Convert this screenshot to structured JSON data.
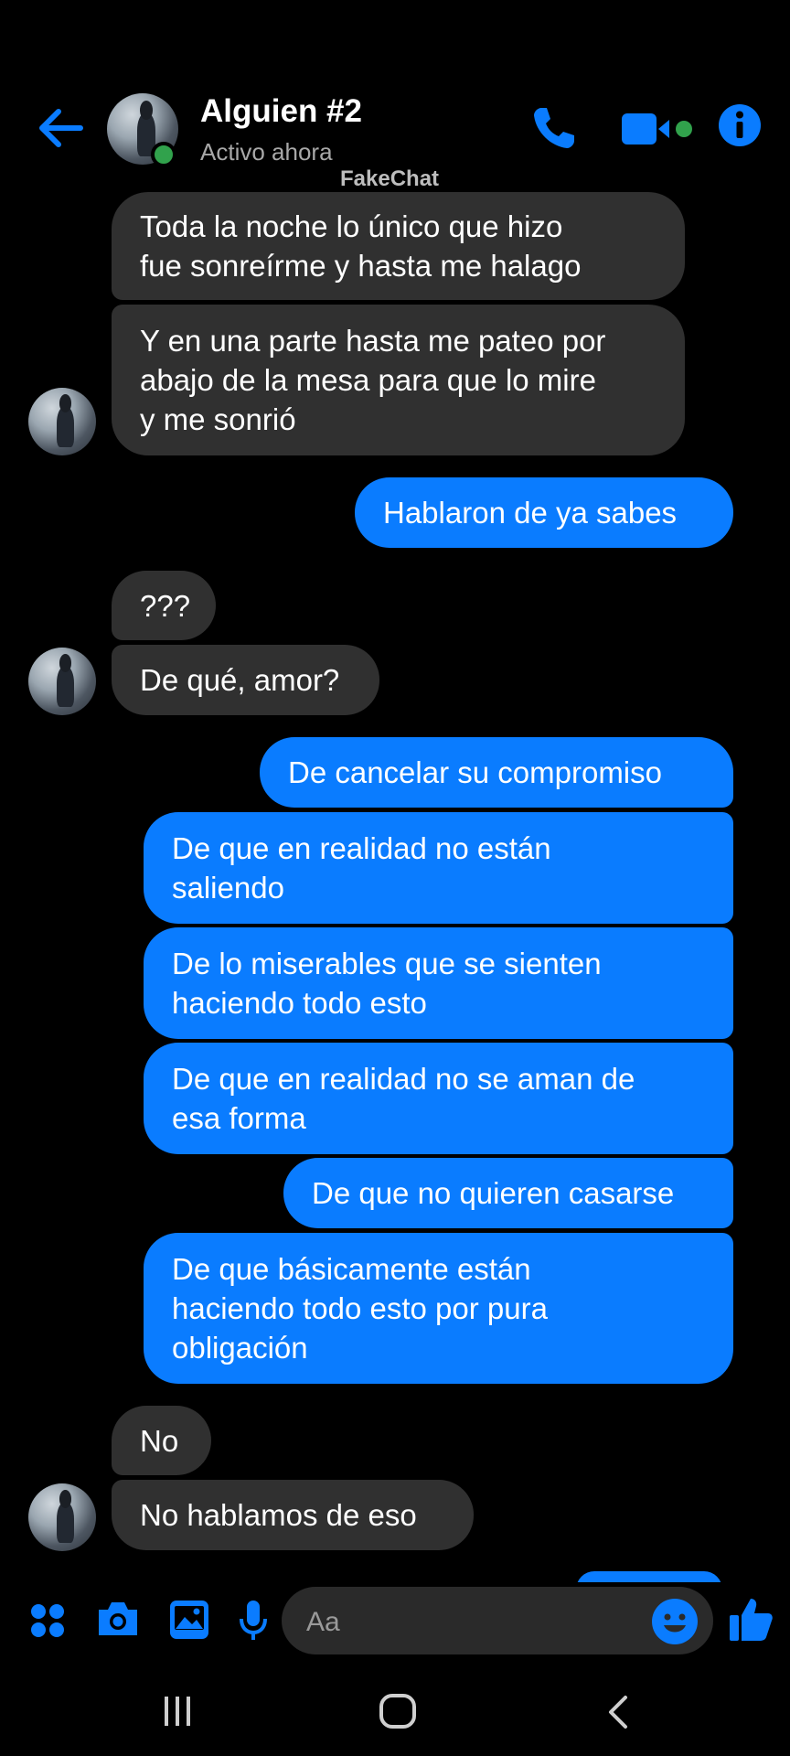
{
  "contact": {
    "name": "Alguien #2",
    "status": "Activo ahora"
  },
  "watermark": "FakeChat",
  "colors": {
    "accent": "#0a7cff",
    "incoming_bubble": "#303030",
    "online": "#31a24c",
    "background": "#000000"
  },
  "messages": [
    {
      "from": "them",
      "lines": [
        "Toda la noche lo único que hizo",
        "fue sonreírme y hasta me halago"
      ]
    },
    {
      "from": "them",
      "lines": [
        "Y en una parte hasta me pateo por",
        "abajo de la mesa para que lo mire",
        "y me sonrió"
      ]
    },
    {
      "from": "me",
      "lines": [
        "Hablaron de ya sabes"
      ]
    },
    {
      "from": "them",
      "lines": [
        "???"
      ]
    },
    {
      "from": "them",
      "lines": [
        "De qué, amor?"
      ]
    },
    {
      "from": "me",
      "lines": [
        "De cancelar su compromiso"
      ]
    },
    {
      "from": "me",
      "lines": [
        "De que en realidad no están",
        "saliendo"
      ]
    },
    {
      "from": "me",
      "lines": [
        "De lo miserables que se sienten",
        "haciendo todo esto"
      ]
    },
    {
      "from": "me",
      "lines": [
        "De que en realidad no se aman de",
        "esa forma"
      ]
    },
    {
      "from": "me",
      "lines": [
        "De que no quieren casarse"
      ]
    },
    {
      "from": "me",
      "lines": [
        "De que básicamente están",
        "haciendo todo esto por pura",
        "obligación"
      ]
    },
    {
      "from": "them",
      "lines": [
        "No"
      ]
    },
    {
      "from": "them",
      "lines": [
        "No hablamos de eso"
      ]
    }
  ],
  "composer": {
    "placeholder": "Aa",
    "icons": [
      "apps-icon",
      "camera-icon",
      "gallery-icon",
      "mic-icon",
      "emoji-icon",
      "like-icon"
    ]
  },
  "header_icons": [
    "back-arrow-icon",
    "phone-icon",
    "video-icon",
    "info-icon"
  ],
  "navbar_icons": [
    "recents-icon",
    "home-icon",
    "back-icon"
  ]
}
